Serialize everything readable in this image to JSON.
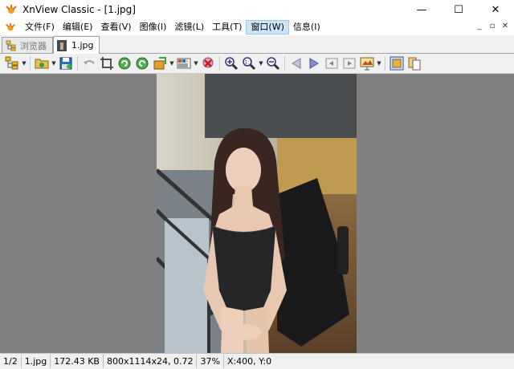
{
  "window": {
    "title": "XnView Classic - [1.jpg]",
    "minimize_glyph": "—",
    "maximize_glyph": "☐",
    "close_glyph": "✕"
  },
  "menu": {
    "items": [
      {
        "label": "文件(F)"
      },
      {
        "label": "编辑(E)"
      },
      {
        "label": "查看(V)"
      },
      {
        "label": "图像(I)"
      },
      {
        "label": "滤镜(L)"
      },
      {
        "label": "工具(T)"
      },
      {
        "label": "窗口(W)"
      },
      {
        "label": "信息(I)"
      }
    ],
    "mdi_minimize": "_",
    "mdi_restore": "▫",
    "mdi_close": "✕"
  },
  "tabs": [
    {
      "label": "浏览器"
    },
    {
      "label": "1.jpg"
    }
  ],
  "toolbar": {
    "icons": [
      "browser-icon",
      "open-folder-icon",
      "save-icon",
      "undo-icon",
      "crop-icon",
      "rotate-left-icon",
      "rotate-right-icon",
      "adjust-icon",
      "palette-icon",
      "delete-icon",
      "zoom-in-icon",
      "zoom-fit-icon",
      "zoom-out-icon",
      "previous-icon",
      "next-icon",
      "first-page-icon",
      "last-page-icon",
      "slideshow-icon",
      "fullscreen-icon",
      "copy-icon"
    ]
  },
  "status": {
    "page": "1/2",
    "filename": "1.jpg",
    "filesize": "172.43 KB",
    "dimensions": "800x1114x24, 0.72",
    "zoom": "37%",
    "coords": "X:400, Y:0"
  },
  "colors": {
    "viewer_bg": "#808080",
    "chrome_bg": "#f0f0f0",
    "menu_active_bg": "#cce4f7"
  }
}
